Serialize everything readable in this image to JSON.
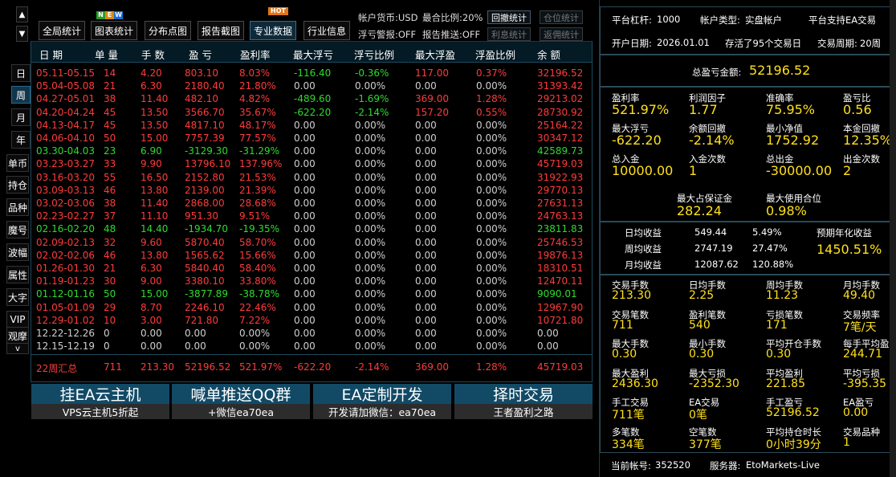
{
  "rail": {
    "up": "▲",
    "down": "▼",
    "period_buttons": [
      "日",
      "周",
      "月",
      "年"
    ],
    "tool_buttons": [
      "单币",
      "持仓",
      "品种",
      "魔号",
      "波幅",
      "属性",
      "大字",
      "VIP",
      "观摩"
    ],
    "collapse": "v"
  },
  "toolbar": {
    "buttons": [
      "全局统计",
      "图表统计",
      "分布点图",
      "报告截图",
      "专业数据",
      "行业信息"
    ],
    "new_badge": [
      "N",
      "E",
      "W"
    ],
    "hot_badge": "HOT",
    "account_currency": "帐户货币:USD",
    "max_ratio": "最合比例:20%",
    "float_warning": "浮亏警报:OFF",
    "report_push": "报告推送:OFF",
    "buttons_right": [
      "回撤统计",
      "仓位统计",
      "利息统计",
      "返佣统计"
    ]
  },
  "table": {
    "headers": [
      "日 期",
      "单 量",
      "手 数",
      "盈 亏",
      "盈利率",
      "最大浮亏",
      "浮亏比例",
      "最大浮盈",
      "浮盈比例",
      "余 额"
    ],
    "rows": [
      {
        "c": "red",
        "v": [
          "05.11-05.15",
          "14",
          "4.20",
          "803.10",
          "8.03%",
          "-116.40",
          "-0.36%",
          "117.00",
          "0.37%",
          "32196.52"
        ]
      },
      {
        "c": "red",
        "v": [
          "05.04-05.08",
          "21",
          "6.30",
          "2180.40",
          "21.80%",
          "0.00",
          "0.00%",
          "0.00",
          "0.00%",
          "31393.42"
        ]
      },
      {
        "c": "red",
        "v": [
          "04.27-05.01",
          "38",
          "11.40",
          "482.10",
          "4.82%",
          "-489.60",
          "-1.69%",
          "369.00",
          "1.28%",
          "29213.02"
        ]
      },
      {
        "c": "red",
        "v": [
          "04.20-04.24",
          "45",
          "13.50",
          "3566.70",
          "35.67%",
          "-622.20",
          "-2.14%",
          "157.20",
          "0.55%",
          "28730.92"
        ]
      },
      {
        "c": "red",
        "v": [
          "04.13-04.17",
          "45",
          "13.50",
          "4817.10",
          "48.17%",
          "0.00",
          "0.00%",
          "0.00",
          "0.00%",
          "25164.22"
        ]
      },
      {
        "c": "red",
        "v": [
          "04.06-04.10",
          "50",
          "15.00",
          "7757.39",
          "77.57%",
          "0.00",
          "0.00%",
          "0.00",
          "0.00%",
          "30347.12"
        ]
      },
      {
        "c": "green",
        "v": [
          "03.30-04.03",
          "23",
          "6.90",
          "-3129.30",
          "-31.29%",
          "0.00",
          "0.00%",
          "0.00",
          "0.00%",
          "42589.73"
        ]
      },
      {
        "c": "red",
        "v": [
          "03.23-03.27",
          "33",
          "9.90",
          "13796.10",
          "137.96%",
          "0.00",
          "0.00%",
          "0.00",
          "0.00%",
          "45719.03"
        ]
      },
      {
        "c": "red",
        "v": [
          "03.16-03.20",
          "55",
          "16.50",
          "2152.80",
          "21.53%",
          "0.00",
          "0.00%",
          "0.00",
          "0.00%",
          "31922.93"
        ]
      },
      {
        "c": "red",
        "v": [
          "03.09-03.13",
          "46",
          "13.80",
          "2139.00",
          "21.39%",
          "0.00",
          "0.00%",
          "0.00",
          "0.00%",
          "29770.13"
        ]
      },
      {
        "c": "red",
        "v": [
          "03.02-03.06",
          "38",
          "11.40",
          "2868.00",
          "28.68%",
          "0.00",
          "0.00%",
          "0.00",
          "0.00%",
          "27631.13"
        ]
      },
      {
        "c": "red",
        "v": [
          "02.23-02.27",
          "37",
          "11.10",
          "951.30",
          "9.51%",
          "0.00",
          "0.00%",
          "0.00",
          "0.00%",
          "24763.13"
        ]
      },
      {
        "c": "green",
        "v": [
          "02.16-02.20",
          "48",
          "14.40",
          "-1934.70",
          "-19.35%",
          "0.00",
          "0.00%",
          "0.00",
          "0.00%",
          "23811.83"
        ]
      },
      {
        "c": "red",
        "v": [
          "02.09-02.13",
          "32",
          "9.60",
          "5870.40",
          "58.70%",
          "0.00",
          "0.00%",
          "0.00",
          "0.00%",
          "25746.53"
        ]
      },
      {
        "c": "red",
        "v": [
          "02.02-02.06",
          "46",
          "13.80",
          "1565.62",
          "15.66%",
          "0.00",
          "0.00%",
          "0.00",
          "0.00%",
          "19876.13"
        ]
      },
      {
        "c": "red",
        "v": [
          "01.26-01.30",
          "21",
          "6.30",
          "5840.40",
          "58.40%",
          "0.00",
          "0.00%",
          "0.00",
          "0.00%",
          "18310.51"
        ]
      },
      {
        "c": "red",
        "v": [
          "01.19-01.23",
          "30",
          "9.00",
          "3380.10",
          "33.80%",
          "0.00",
          "0.00%",
          "0.00",
          "0.00%",
          "12470.11"
        ]
      },
      {
        "c": "green",
        "v": [
          "01.12-01.16",
          "50",
          "15.00",
          "-3877.89",
          "-38.78%",
          "0.00",
          "0.00%",
          "0.00",
          "0.00%",
          "9090.01"
        ]
      },
      {
        "c": "red",
        "v": [
          "01.05-01.09",
          "29",
          "8.70",
          "2246.10",
          "22.46%",
          "0.00",
          "0.00%",
          "0.00",
          "0.00%",
          "12967.90"
        ]
      },
      {
        "c": "red",
        "v": [
          "12.29-01.02",
          "10",
          "3.00",
          "721.80",
          "7.22%",
          "0.00",
          "0.00%",
          "0.00",
          "0.00%",
          "10721.80"
        ]
      },
      {
        "c": "gray",
        "v": [
          "12.22-12.26",
          "0",
          "0.00",
          "0.00",
          "0.00%",
          "0.00",
          "0.00%",
          "0.00",
          "0.00%",
          "0.00"
        ]
      },
      {
        "c": "gray",
        "v": [
          "12.15-12.19",
          "0",
          "0.00",
          "0.00",
          "0.00%",
          "0.00",
          "0.00%",
          "0.00",
          "0.00%",
          "0.00"
        ]
      }
    ],
    "summary": [
      "22周汇总",
      "711",
      "213.30",
      "52196.52",
      "521.97%",
      "-622.20",
      "-2.14%",
      "369.00",
      "1.28%",
      "45719.03"
    ]
  },
  "promos": [
    {
      "title": "挂EA云主机",
      "sub": "VPS云主机5折起"
    },
    {
      "title": "喊单推送QQ群",
      "sub": "+微信ea70ea"
    },
    {
      "title": "EA定制开发",
      "sub": "开发请加微信：ea70ea"
    },
    {
      "title": "择时交易",
      "sub": "王者盈利之路"
    }
  ],
  "right": {
    "platform_leverage_label": "平台杠杆:",
    "platform_leverage": "1000",
    "account_type_label": "帐户类型:",
    "account_type": "实盘帐户",
    "ea_support": "平台支持EA交易",
    "open_date_label": "开户日期:",
    "open_date": "2026.01.01",
    "live_days": "存活了95个交易日",
    "trade_cycle_label": "交易周期:",
    "trade_cycle": "20周",
    "total_profit_label": "总盈亏金额:",
    "total_profit": "52196.52",
    "stats1": [
      {
        "l": "盈利率",
        "v": "521.97%"
      },
      {
        "l": "利润因子",
        "v": "1.77"
      },
      {
        "l": "准确率",
        "v": "75.95%"
      },
      {
        "l": "盈亏比",
        "v": "0.56"
      },
      {
        "l": "最大浮亏",
        "v": "-622.20"
      },
      {
        "l": "余额回撤",
        "v": "-2.14%"
      },
      {
        "l": "最小净值",
        "v": "1752.92"
      },
      {
        "l": "本金回撤",
        "v": "12.35%"
      },
      {
        "l": "总入金",
        "v": "10000.00"
      },
      {
        "l": "入金次数",
        "v": "1"
      },
      {
        "l": "总出金",
        "v": "-30000.00"
      },
      {
        "l": "出金次数",
        "v": "2"
      }
    ],
    "margin": [
      {
        "l": "最大占保证金",
        "v": "282.24"
      },
      {
        "l": "最大使用合位",
        "v": "0.98%"
      }
    ],
    "returns": [
      {
        "l": "日均收益",
        "v": "549.44",
        "p": "5.49%"
      },
      {
        "l": "周均收益",
        "v": "2747.19",
        "p": "27.47%"
      },
      {
        "l": "月均收益",
        "v": "12087.62",
        "p": "120.88%"
      }
    ],
    "annual_label": "预期年化收益",
    "annual": "1450.51%",
    "stats2": [
      {
        "l": "交易手数",
        "v": "213.30"
      },
      {
        "l": "日均手数",
        "v": "2.25"
      },
      {
        "l": "周均手数",
        "v": "11.23"
      },
      {
        "l": "月均手数",
        "v": "49.40"
      },
      {
        "l": "交易笔数",
        "v": "711"
      },
      {
        "l": "盈利笔数",
        "v": "540"
      },
      {
        "l": "亏损笔数",
        "v": "171"
      },
      {
        "l": "交易频率",
        "v": "7笔/天"
      },
      {
        "l": "最大手数",
        "v": "0.30"
      },
      {
        "l": "最小手数",
        "v": "0.30"
      },
      {
        "l": "平均开仓手数",
        "v": "0.30"
      },
      {
        "l": "每手平均盈亏",
        "v": "244.71"
      },
      {
        "l": "最大盈利",
        "v": "2436.30"
      },
      {
        "l": "最大亏损",
        "v": "-2352.30"
      },
      {
        "l": "平均盈利",
        "v": "221.85"
      },
      {
        "l": "平均亏损",
        "v": "-395.35"
      },
      {
        "l": "手工交易",
        "v": "711笔"
      },
      {
        "l": "EA交易",
        "v": "0笔"
      },
      {
        "l": "手工盈亏",
        "v": "52196.52"
      },
      {
        "l": "EA盈亏",
        "v": "0.00"
      },
      {
        "l": "多笔数",
        "v": "334笔"
      },
      {
        "l": "空笔数",
        "v": "377笔"
      },
      {
        "l": "平均持仓时长",
        "v": "0小时39分"
      },
      {
        "l": "交易品种",
        "v": "1"
      }
    ],
    "account_label": "当前帐号:",
    "account": "352520",
    "server_label": "服务器:",
    "server": "EtoMarkets-Live"
  },
  "colors": {
    "profit": "#ff3b3b",
    "loss": "#2edb2e",
    "highlight": "#ffe01a",
    "accent": "#124a66"
  }
}
